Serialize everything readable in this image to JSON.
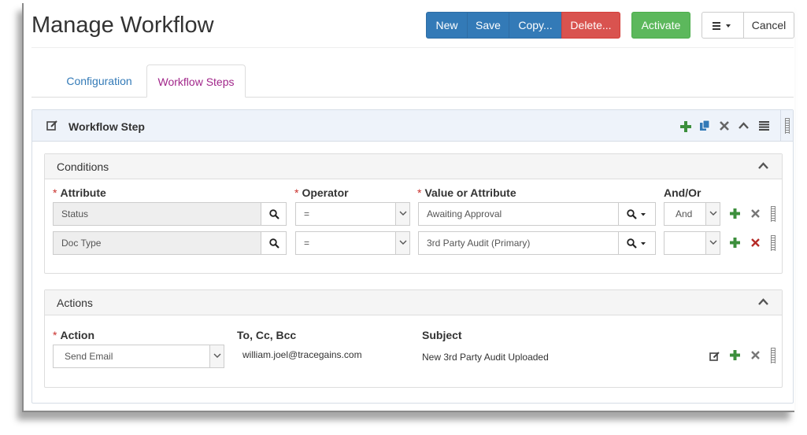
{
  "page": {
    "title": "Manage Workflow"
  },
  "toolbar": {
    "new_label": "New",
    "save_label": "Save",
    "copy_label": "Copy...",
    "delete_label": "Delete...",
    "activate_label": "Activate",
    "cancel_label": "Cancel",
    "menu_icon": "hamburger-caret-icon"
  },
  "tabs": [
    {
      "label": "Configuration",
      "active": false
    },
    {
      "label": "Workflow Steps",
      "active": true
    }
  ],
  "workflow_step": {
    "title": "Workflow Step",
    "header_icons": [
      "edit-icon",
      "add-icon",
      "copy-icon",
      "remove-icon",
      "collapse-icon",
      "list-icon",
      "drag-handle-icon"
    ]
  },
  "conditions": {
    "title": "Conditions",
    "columns": {
      "attribute": "Attribute",
      "operator": "Operator",
      "value": "Value or Attribute",
      "andor": "And/Or"
    },
    "required_marker": "*",
    "rows": [
      {
        "attribute": "Status",
        "operator": "=",
        "value": "Awaiting Approval",
        "andor": "And"
      },
      {
        "attribute": "Doc Type",
        "operator": "=",
        "value": "3rd Party Audit (Primary)",
        "andor": ""
      }
    ]
  },
  "actions": {
    "title": "Actions",
    "columns": {
      "action": "Action",
      "recipients": "To, Cc, Bcc",
      "subject": "Subject"
    },
    "rows": [
      {
        "action": "Send Email",
        "recipients": "william.joel@tracegains.com",
        "subject": "New 3rd Party Audit Uploaded"
      }
    ]
  },
  "colors": {
    "primary": "#337ab7",
    "danger": "#d9534f",
    "success": "#5cb85c",
    "active_tab": "#a1268a",
    "add_icon": "#3c8f3c",
    "remove_icon": "#b52b27"
  }
}
